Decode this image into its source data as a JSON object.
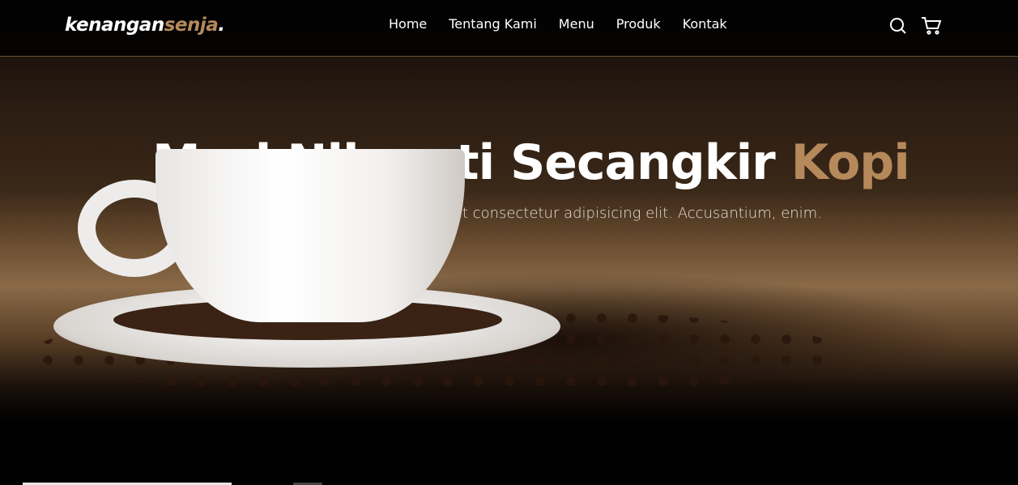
{
  "logo": {
    "main": "kenangan",
    "accent": "senja",
    "dot": "."
  },
  "nav": {
    "items": [
      "Home",
      "Tentang Kami",
      "Menu",
      "Produk",
      "Kontak"
    ]
  },
  "icons": [
    "search-icon",
    "cart-icon"
  ],
  "hero": {
    "title_main": "Mari Nikmati Secangkir ",
    "title_accent": "Kopi",
    "subtitle": "Lorem ipsum dolor sit amet consectetur adipisicing elit. Accusantium, enim."
  },
  "colors": {
    "accent": "#b6895b"
  }
}
